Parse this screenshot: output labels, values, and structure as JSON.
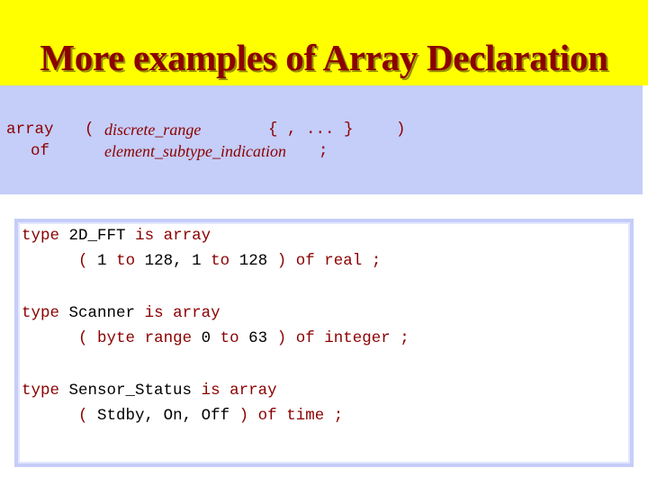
{
  "slide": {
    "title": "More examples of Array Declaration"
  },
  "syntax": {
    "kw_array": "array",
    "kw_of": "of",
    "open_paren": "(",
    "discrete_range": "discrete_range",
    "repeat_part": "{ , ... }",
    "close_paren": ")",
    "element_subtype": "element_subtype_indication",
    "semicolon": ";"
  },
  "examples": {
    "ex1": {
      "line1": {
        "kw_type": "type",
        "name": "2D_FFT",
        "kw_is": "is",
        "kw_array": "array"
      },
      "line2": {
        "open": "(",
        "v1": "1",
        "kw_to1": "to",
        "v2": "128,",
        "v3": "1",
        "kw_to2": "to",
        "v4": "128",
        "close": ")",
        "kw_of": "of",
        "kw_real": "real",
        "semi": ";"
      }
    },
    "ex2": {
      "line1": {
        "kw_type": "type",
        "name": "Scanner",
        "kw_is": "is",
        "kw_array": "array"
      },
      "line2": {
        "open": "(",
        "byte": "byte",
        "kw_range": "range",
        "v1": "0",
        "kw_to": "to",
        "v2": "63",
        "close": ")",
        "kw_of": "of",
        "kw_integer": "integer",
        "semi": ";"
      }
    },
    "ex3": {
      "line1": {
        "kw_type": "type",
        "name": "Sensor_Status",
        "kw_is": "is",
        "kw_array": "array"
      },
      "line2": {
        "open": "(",
        "e1": "Stdby,",
        "e2": "On,",
        "e3": "Off",
        "close": ")",
        "kw_of": "of",
        "kw_time": "time",
        "semi": ";"
      }
    }
  },
  "colors": {
    "title_band": "#ffff00",
    "title_text": "#8b0000",
    "syntax_bg": "#c5cdf9",
    "keyword": "#8b0000"
  }
}
